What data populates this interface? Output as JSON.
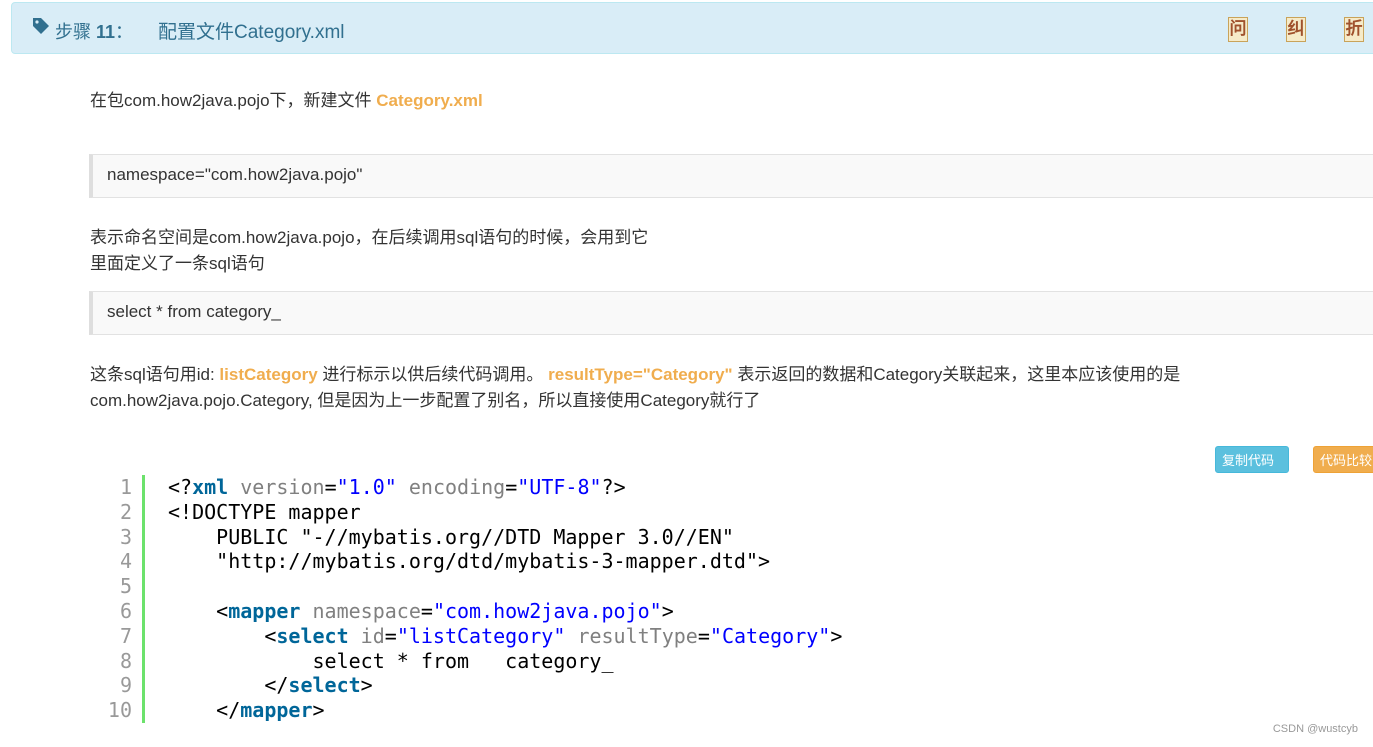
{
  "step": {
    "label_prefix": "步骤",
    "number": "11",
    "separator": "：",
    "title": "配置文件Category.xml",
    "buttons": [
      "问",
      "纠",
      "折"
    ]
  },
  "intro": {
    "text": "在包com.how2java.pojo下，新建文件",
    "highlight": "Category.xml"
  },
  "snippet1": "namespace=\"com.how2java.pojo\"",
  "explain1": {
    "line1": "表示命名空间是com.how2java.pojo，在后续调用sql语句的时候，会用到它",
    "line2": "里面定义了一条sql语句"
  },
  "snippet2": "select * from   category_",
  "explain2": {
    "part1": "这条sql语句用id: ",
    "hl1": "listCategory",
    "part2": " 进行标示以供后续代码调用。",
    "hl2": "resultType=\"Category\"",
    "part3": " 表示返回的数据和Category关联起来，这里本应该使用的是",
    "line2": "com.how2java.pojo.Category, 但是因为上一步配置了别名，所以直接使用Category就行了"
  },
  "code_buttons": {
    "copy": "复制代码",
    "compare": "代码比较"
  },
  "code": {
    "line_numbers": [
      "1",
      "2",
      "3",
      "4",
      "5",
      "6",
      "7",
      "8",
      "9",
      "10"
    ],
    "l1": {
      "open": "<?",
      "tag": "xml",
      "attr1": "version",
      "eq1": "=",
      "val1": "\"1.0\"",
      "attr2": "encoding",
      "eq2": "=",
      "val2": "\"UTF-8\"",
      "close": "?>"
    },
    "l2": "<!DOCTYPE mapper",
    "l3": "    PUBLIC \"-//mybatis.org//DTD Mapper 3.0//EN\"",
    "l4": "    \"http://mybatis.org/dtd/mybatis-3-mapper.dtd\">",
    "l6": {
      "indent": "    ",
      "open": "<",
      "tag": "mapper",
      "attr": "namespace",
      "eq": "=",
      "val": "\"com.how2java.pojo\"",
      "close": ">"
    },
    "l7": {
      "indent": "        ",
      "open": "<",
      "tag": "select",
      "attr1": "id",
      "eq1": "=",
      "val1": "\"listCategory\"",
      "attr2": "resultType",
      "eq2": "=",
      "val2": "\"Category\"",
      "close": ">"
    },
    "l8": "            select * from   category_",
    "l9": {
      "indent": "        ",
      "open": "</",
      "tag": "select",
      "close": ">"
    },
    "l10": {
      "indent": "    ",
      "open": "</",
      "tag": "mapper",
      "close": ">"
    }
  },
  "watermark": "CSDN @wustcyb",
  "colors": {
    "header_bg": "#d9edf7",
    "header_text": "#31708f",
    "highlight": "#f0ad4e",
    "code_keyword": "#006699",
    "code_string": "#0000ff",
    "code_attr": "#808080",
    "gutter_bar": "#6ce26c"
  },
  "icons": {
    "step": "tag-icon"
  }
}
